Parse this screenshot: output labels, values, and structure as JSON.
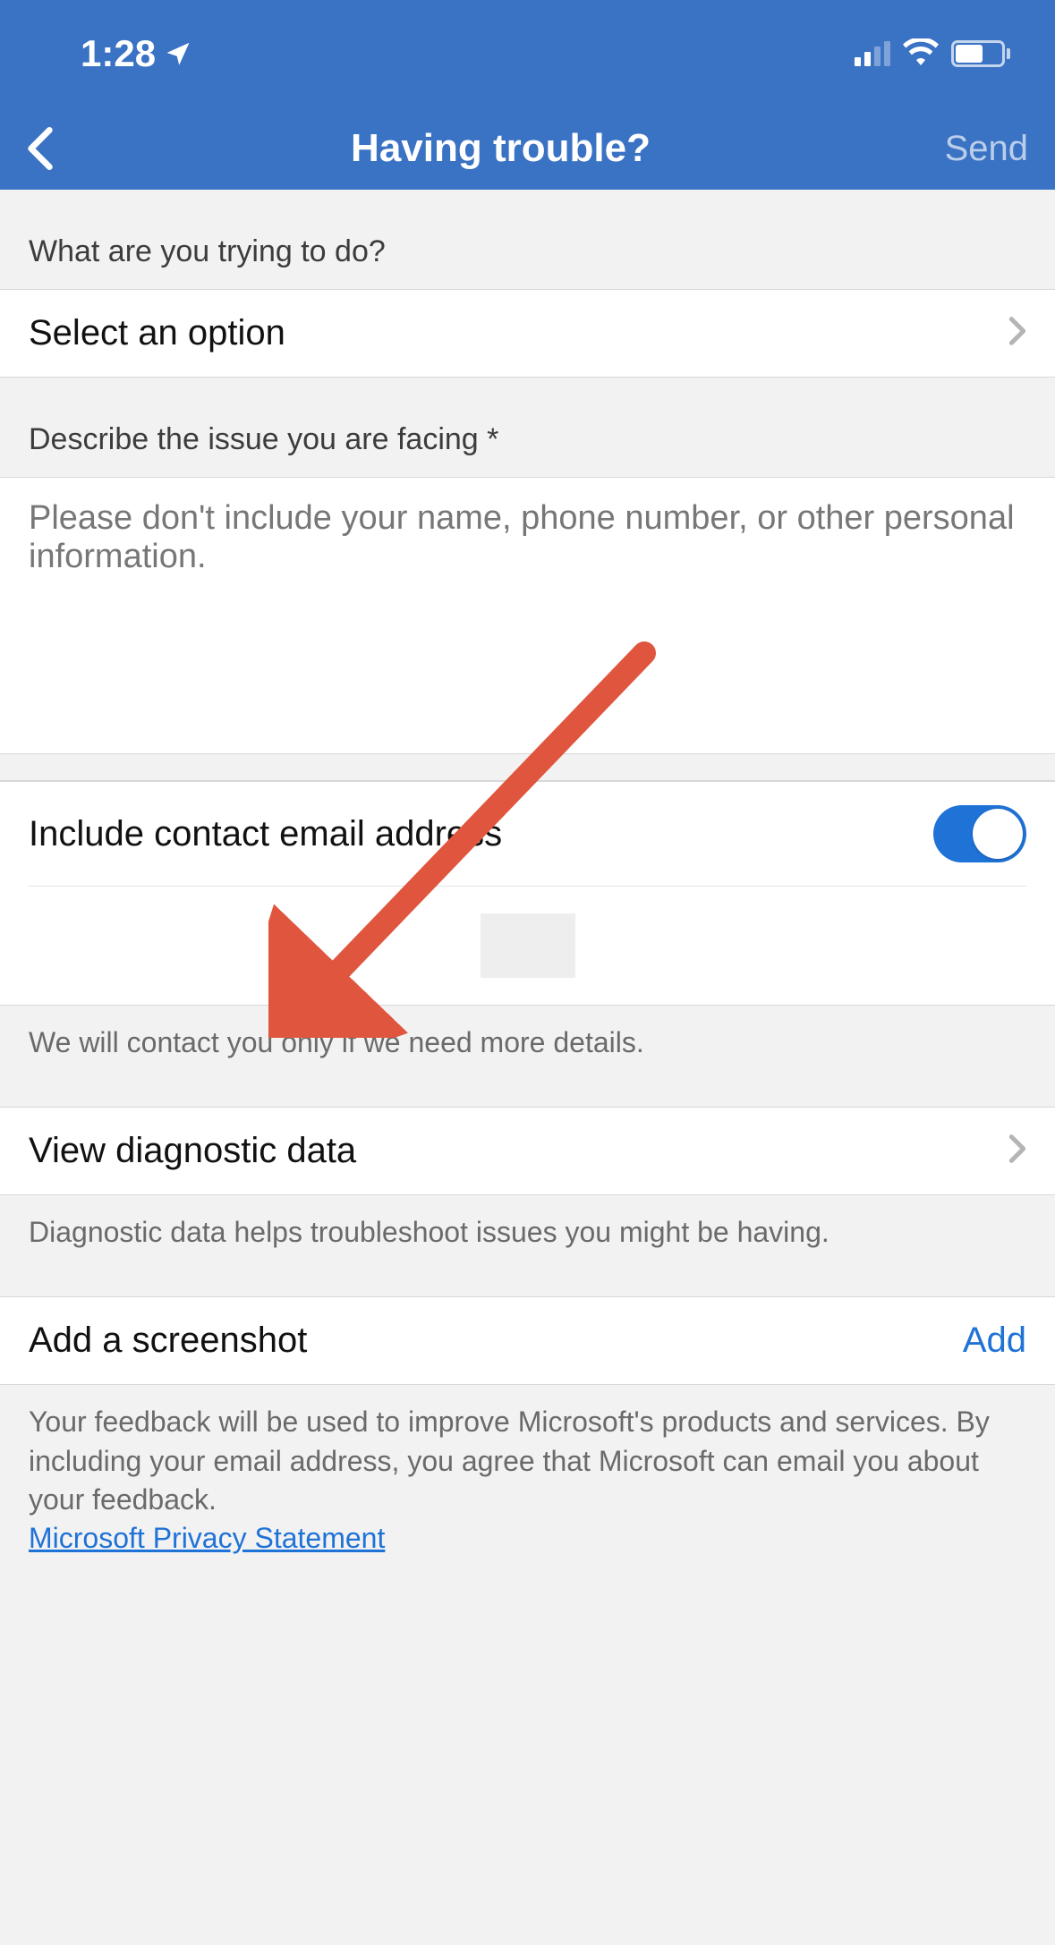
{
  "statusbar": {
    "time": "1:28"
  },
  "navbar": {
    "title": "Having trouble?",
    "action": "Send"
  },
  "section1": {
    "header": "What are you trying to do?",
    "select_placeholder": "Select an option"
  },
  "section2": {
    "header": "Describe the issue you are facing *",
    "placeholder": "Please don't include your name, phone number, or other personal information."
  },
  "section3": {
    "include_email_label": "Include contact email address",
    "footer": "We will contact you only if we need more details."
  },
  "section4": {
    "label": "View diagnostic data",
    "footer": "Diagnostic data helps troubleshoot issues you might be having."
  },
  "section5": {
    "label": "Add a screenshot",
    "action": "Add"
  },
  "section6": {
    "disclaimer": "Your feedback will be used to improve Microsoft's products and services. By including your email address, you agree that Microsoft can email you about your feedback.",
    "privacy_link": "Microsoft Privacy Statement"
  }
}
